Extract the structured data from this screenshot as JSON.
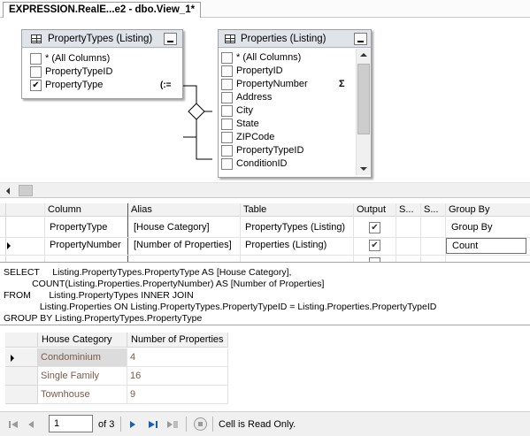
{
  "tab": {
    "title": "EXPRESSION.RealE...e2 - dbo.View_1*"
  },
  "diagram": {
    "table1": {
      "title": "PropertyTypes (Listing)",
      "columns": [
        {
          "name": "* (All Columns)",
          "checked": false
        },
        {
          "name": "PropertyTypeID",
          "checked": false
        },
        {
          "name": "PropertyType",
          "checked": true
        }
      ]
    },
    "table2": {
      "title": "Properties (Listing)",
      "columns": [
        {
          "name": "* (All Columns)",
          "checked": false
        },
        {
          "name": "PropertyID",
          "checked": false
        },
        {
          "name": "PropertyNumber",
          "checked": false
        },
        {
          "name": "Address",
          "checked": false
        },
        {
          "name": "City",
          "checked": false
        },
        {
          "name": "State",
          "checked": false
        },
        {
          "name": "ZIPCode",
          "checked": false
        },
        {
          "name": "PropertyTypeID",
          "checked": false
        },
        {
          "name": "ConditionID",
          "checked": false
        }
      ]
    }
  },
  "criteria": {
    "headers": [
      "Column",
      "Alias",
      "Table",
      "Output",
      "S...",
      "S...",
      "Group By"
    ],
    "rows": [
      {
        "column": "PropertyType",
        "alias": "[House Category]",
        "table": "PropertyTypes (Listing)",
        "output": true,
        "groupby": "Group By"
      },
      {
        "column": "PropertyNumber",
        "alias": "[Number of Properties]",
        "table": "Properties (Listing)",
        "output": true,
        "groupby": "Count"
      }
    ]
  },
  "sql": {
    "lines": [
      "SELECT     Listing.PropertyTypes.PropertyType AS [House Category],",
      "           COUNT(Listing.Properties.PropertyNumber) AS [Number of Properties]",
      "FROM       Listing.PropertyTypes INNER JOIN",
      "              Listing.Properties ON Listing.PropertyTypes.PropertyTypeID = Listing.Properties.PropertyTypeID",
      "GROUP BY Listing.PropertyTypes.PropertyType"
    ]
  },
  "results": {
    "headers": [
      "House Category",
      "Number of Properties"
    ],
    "rows": [
      {
        "category": "Condominium",
        "count": "4"
      },
      {
        "category": "Single Family",
        "count": "16"
      },
      {
        "category": "Townhouse",
        "count": "9"
      }
    ]
  },
  "nav": {
    "page": "1",
    "of_pages": "of 3",
    "status": "Cell is Read Only."
  },
  "icons": {
    "sigma": "Σ",
    "groupby": "grouping-icon",
    "nav_first": "first-record-icon",
    "nav_prev": "previous-record-icon",
    "nav_next": "next-record-icon",
    "nav_last": "last-record-icon",
    "nav_new": "new-record-icon",
    "nav_stop": "stop-icon"
  },
  "colors": {
    "result_text": "#7a5a4a",
    "title_bg": "#dfe3ea",
    "nav_blue": "#1a5fb4"
  }
}
